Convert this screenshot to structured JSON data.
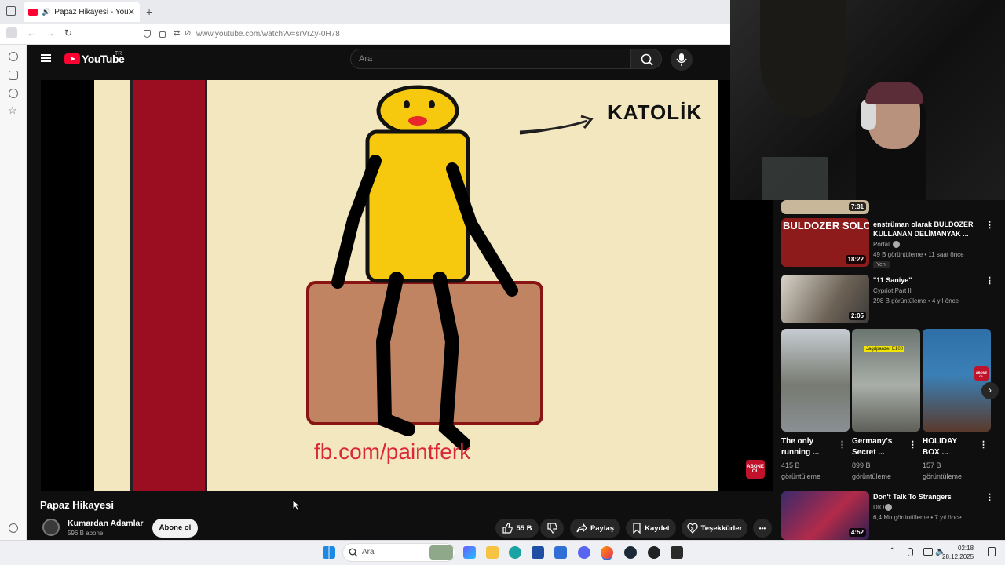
{
  "browser": {
    "tab_title": "Papaz Hikayesi - YouTube",
    "tab_close": "✕",
    "new_tab": "+",
    "url": "www.youtube.com/watch?v=srVrZy-0H78"
  },
  "youtube": {
    "logo_text": "YouTube",
    "country": "TR",
    "search_placeholder": "Ara"
  },
  "video": {
    "frame_text_1": "KATOLİK",
    "frame_text_2": "fb.com/paintferk",
    "watermark": "ABONE OL",
    "title": "Papaz Hikayesi",
    "channel": "Kumardan Adamlar",
    "subscribers": "596 B abone",
    "subscribe_label": "Abone ol",
    "likes": "55 B",
    "share_label": "Paylaş",
    "save_label": "Kaydet",
    "thanks_label": "Teşekkürler",
    "more": "•••"
  },
  "recommendations": [
    {
      "duration": "7:31"
    },
    {
      "title_1": "enstrüman olarak BULDOZER",
      "title_2": "KULLANAN DELİMANYAK ...",
      "channel": "Portal",
      "meta": "49 B görüntüleme • 11 saat önce",
      "badge": "Yeni",
      "duration": "18:22",
      "thumb_text": "BULDOZER SOLO"
    },
    {
      "title_1": "\"11 Saniye\"",
      "channel": "Cypriot Part II",
      "meta": "298 B görüntüleme • 4 yıl önce",
      "duration": "2:05"
    },
    {
      "title_1": "Don't Talk To Strangers",
      "channel": "DIO",
      "meta": "6,4 Mn görüntüleme • 7 yıl önce",
      "duration": "4:52"
    }
  ],
  "shorts": [
    {
      "title_1": "The only",
      "title_2": "running ...",
      "views_1": "415 B",
      "views_2": "görüntüleme"
    },
    {
      "title_1": "Germany's",
      "title_2": "Secret ...",
      "views_1": "899 B",
      "views_2": "görüntüleme",
      "thumb_label": "Jagdpanzer E100"
    },
    {
      "title_1": "HOLIDAY",
      "title_2": "BOX ...",
      "views_1": "157 B",
      "views_2": "görüntüleme",
      "thumb_label": "ABONE OL"
    }
  ],
  "taskbar": {
    "search_placeholder": "Ara",
    "time": "02:18",
    "date": "28.12.2025"
  }
}
